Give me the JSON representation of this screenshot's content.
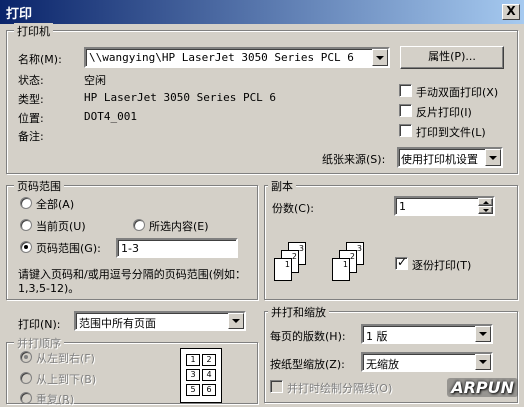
{
  "window": {
    "title": "打印",
    "close_glyph": "X"
  },
  "printer": {
    "group_label": "打印机",
    "name_label": "名称(M):",
    "name_value": "\\\\wangying\\HP LaserJet 3050 Series PCL 6",
    "properties_button": "属性(P)...",
    "status_label": "状态:",
    "status_value": "空闲",
    "type_label": "类型:",
    "type_value": "HP LaserJet 3050 Series PCL 6",
    "location_label": "位置:",
    "location_value": "DOT4_001",
    "comment_label": "备注:",
    "manual_duplex": "手动双面打印(X)",
    "manual_duplex_checked": false,
    "reverse_print": "反片打印(I)",
    "reverse_print_checked": false,
    "print_to_file": "打印到文件(L)",
    "print_to_file_checked": false,
    "paper_source_label": "纸张来源(S):",
    "paper_source_value": "使用打印机设置"
  },
  "page_range": {
    "group_label": "页码范围",
    "all": "全部(A)",
    "current_page": "当前页(U)",
    "selection": "所选内容(E)",
    "pages": "页码范围(G):",
    "pages_value": "1-3",
    "selected_option": "pages",
    "hint": "请键入页码和/或用逗号分隔的页码范围(例如：1,3,5-12)。"
  },
  "copies": {
    "group_label": "副本",
    "count_label": "份数(C):",
    "count_value": "1",
    "collate": "逐份打印(T)",
    "collate_checked": true,
    "page_numbers": [
      "1",
      "2",
      "3"
    ]
  },
  "print_what": {
    "label": "打印(N):",
    "value": "范围中所有页面"
  },
  "order": {
    "group_label": "并打顺序",
    "left_to_right": "从左到右(F)",
    "top_to_bottom": "从上到下(B)",
    "repeat": "重复(R)",
    "grid_numbers": [
      "1",
      "2",
      "3",
      "4",
      "5",
      "6"
    ]
  },
  "zoom": {
    "group_label": "并打和缩放",
    "pages_per_sheet_label": "每页的版数(H):",
    "pages_per_sheet_value": "1 版",
    "scale_label": "按纸型缩放(Z):",
    "scale_value": "无缩放",
    "draw_borders": "并打时绘制分隔线(O)"
  },
  "watermark": "ARPUN",
  "icons": [
    "close-icon",
    "dropdown-arrow-icon",
    "spin-up-icon",
    "spin-down-icon",
    "collate-pages-icon",
    "order-grid-icon"
  ]
}
